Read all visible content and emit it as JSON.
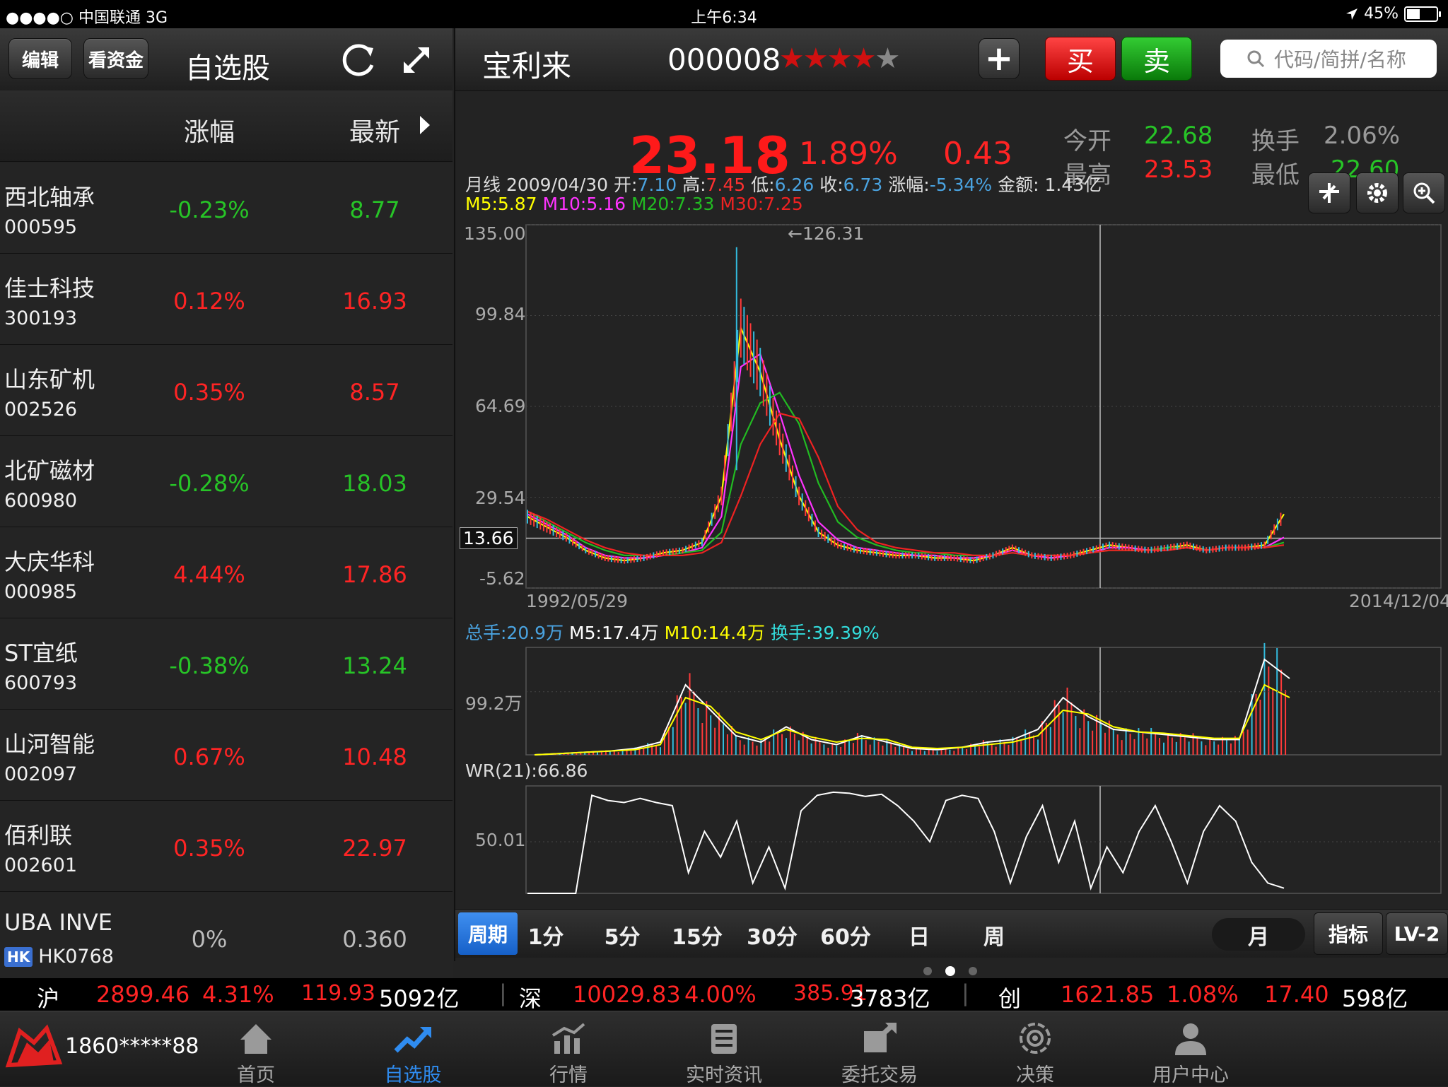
{
  "status_bar": {
    "carrier": "●●●●○ 中国联通  3G",
    "time": "上午6:34",
    "battery": "45%",
    "battery_level": 0.45
  },
  "watchlist": {
    "edit_label": "编辑",
    "funds_label": "看资金",
    "title": "自选股",
    "col_change": "涨幅",
    "col_latest": "最新",
    "rows": [
      {
        "name": "西北轴承",
        "code": "000595",
        "change": "-0.23%",
        "last": "8.77",
        "dir": "down"
      },
      {
        "name": "佳士科技",
        "code": "300193",
        "change": "0.12%",
        "last": "16.93",
        "dir": "up"
      },
      {
        "name": "山东矿机",
        "code": "002526",
        "change": "0.35%",
        "last": "8.57",
        "dir": "up"
      },
      {
        "name": "北矿磁材",
        "code": "600980",
        "change": "-0.28%",
        "last": "18.03",
        "dir": "down"
      },
      {
        "name": "大庆华科",
        "code": "000985",
        "change": "4.44%",
        "last": "17.86",
        "dir": "up"
      },
      {
        "name": "ST宜纸",
        "code": "600793",
        "change": "-0.38%",
        "last": "13.24",
        "dir": "down"
      },
      {
        "name": "山河智能",
        "code": "002097",
        "change": "0.67%",
        "last": "10.48",
        "dir": "up"
      },
      {
        "name": "佰利联",
        "code": "002601",
        "change": "0.35%",
        "last": "22.97",
        "dir": "up"
      },
      {
        "name": "UBA INVE",
        "code": "HK0768",
        "badge": "HK",
        "change": "0%",
        "last": "0.360",
        "dir": "flat"
      }
    ]
  },
  "stock": {
    "name": "宝利来",
    "code": "000008",
    "stars_filled": 4,
    "stars_total": 5,
    "add_label": "+",
    "buy_label": "买",
    "sell_label": "卖",
    "search_placeholder": "代码/简拼/名称",
    "price": "23.18",
    "change_pct": "1.89%",
    "change": "0.43",
    "open_label": "今开",
    "open": "22.68",
    "turnover_label": "换手",
    "turnover": "2.06%",
    "high_label": "最高",
    "high": "23.53",
    "low_label": "最低",
    "low": "22.60"
  },
  "chart_info": {
    "period": "月线",
    "date": "2009/04/30",
    "open_label": "开:",
    "open": "7.10",
    "high_label": "高:",
    "high": "7.45",
    "low_label": "低:",
    "low": "6.26",
    "close_label": "收:",
    "close": "6.73",
    "chg_label": "涨幅:",
    "chg": "-5.34%",
    "amount_label": "金额:",
    "amount": "1.43亿",
    "ma5": "M5:5.87",
    "ma10": "M10:5.16",
    "ma20": "M20:7.33",
    "ma30": "M30:7.25",
    "peak_label": "←126.31",
    "ref_price": "13.66",
    "start_date": "1992/05/29",
    "end_date": "2014/12/04",
    "vol_total": "总手:20.9万",
    "vol_m5": "M5:17.4万",
    "vol_m10": "M10:14.4万",
    "vol_turn": "换手:39.39%",
    "wr_label": "WR(21):66.86"
  },
  "chart_data": [
    {
      "type": "line",
      "title": "",
      "x_range": [
        "1992/05/29",
        "2014/12/04"
      ],
      "y_ticks": [
        135.0,
        99.84,
        64.69,
        29.54,
        13.66,
        -5.62
      ],
      "ylim": [
        -5.62,
        135.0
      ],
      "annotations": [
        {
          "label": "←126.31",
          "value": 126.31
        }
      ],
      "series": [
        {
          "name": "M5",
          "color": "#ffff00",
          "values": [
            22,
            18,
            14,
            9,
            6,
            5,
            6,
            8,
            9,
            12,
            30,
            95,
            78,
            52,
            30,
            16,
            11,
            9,
            8,
            7,
            7,
            6,
            6,
            5,
            7,
            10,
            7,
            6,
            7,
            9,
            11,
            10,
            9,
            10,
            11,
            9,
            10,
            10,
            11,
            23
          ]
        },
        {
          "name": "M10",
          "color": "#ff33ff",
          "values": [
            23,
            19,
            15,
            10,
            7,
            6,
            6,
            7,
            8,
            10,
            22,
            80,
            85,
            62,
            38,
            20,
            13,
            10,
            9,
            8,
            7,
            7,
            6,
            6,
            7,
            9,
            7,
            6,
            7,
            8,
            10,
            10,
            9,
            10,
            10,
            9,
            10,
            10,
            10,
            14
          ]
        },
        {
          "name": "M20",
          "color": "#22bb22",
          "values": [
            24,
            20,
            16,
            12,
            9,
            7,
            7,
            7,
            8,
            9,
            16,
            50,
            66,
            70,
            58,
            35,
            20,
            14,
            11,
            9,
            8,
            8,
            7,
            7,
            7,
            8,
            7,
            7,
            7,
            8,
            9,
            9,
            9,
            10,
            10,
            9,
            10,
            10,
            10,
            12
          ]
        },
        {
          "name": "M30",
          "color": "#ee2222",
          "values": [
            24,
            21,
            17,
            13,
            10,
            8,
            7,
            7,
            7,
            8,
            12,
            30,
            50,
            62,
            60,
            45,
            26,
            17,
            12,
            10,
            9,
            8,
            8,
            7,
            7,
            8,
            7,
            7,
            7,
            8,
            9,
            9,
            9,
            9,
            10,
            9,
            10,
            10,
            10,
            11
          ]
        }
      ]
    },
    {
      "type": "bar",
      "title": "",
      "y_ticks_label": [
        "99.2万"
      ],
      "series": [
        {
          "name": "M5",
          "color": "#ffffff",
          "values": [
            0,
            1,
            2,
            3,
            5,
            10,
            55,
            35,
            15,
            10,
            22,
            12,
            8,
            15,
            10,
            5,
            4,
            6,
            10,
            12,
            20,
            45,
            30,
            20,
            18,
            16,
            14,
            12,
            12,
            75,
            60
          ]
        },
        {
          "name": "M10",
          "color": "#ffff00",
          "values": [
            0,
            1,
            2,
            3,
            4,
            8,
            45,
            38,
            18,
            12,
            20,
            14,
            10,
            13,
            12,
            6,
            5,
            6,
            8,
            10,
            15,
            35,
            32,
            22,
            18,
            17,
            15,
            13,
            13,
            55,
            45
          ]
        }
      ]
    },
    {
      "type": "line",
      "title": "",
      "y_ticks": [
        50.01
      ],
      "series": [
        {
          "name": "WR(21)",
          "color": "#ffffff",
          "values": [
            0,
            0,
            0,
            0,
            95,
            90,
            88,
            92,
            88,
            85,
            20,
            60,
            35,
            70,
            10,
            45,
            5,
            80,
            95,
            98,
            97,
            94,
            96,
            85,
            70,
            50,
            90,
            95,
            92,
            60,
            10,
            55,
            85,
            30,
            70,
            5,
            45,
            20,
            60,
            85,
            50,
            10,
            60,
            85,
            70,
            30,
            10,
            5
          ]
        }
      ]
    }
  ],
  "periods": {
    "period_label": "周期",
    "items": [
      "1分",
      "5分",
      "15分",
      "30分",
      "60分",
      "日",
      "周",
      "月"
    ],
    "selected": "月",
    "indicator_label": "指标",
    "lv2_label": "LV-2"
  },
  "ticker": [
    {
      "name": "沪",
      "value": "2899.46",
      "pct": "4.31%",
      "chg": "119.93",
      "amount": "5092亿"
    },
    {
      "name": "深",
      "value": "10029.83",
      "pct": "4.00%",
      "chg": "385.91",
      "amount": "3783亿"
    },
    {
      "name": "创",
      "value": "1621.85",
      "pct": "1.08%",
      "chg": "17.40",
      "amount": "598亿"
    }
  ],
  "user": {
    "phone": "1860*****88"
  },
  "tabs": [
    {
      "label": "首页",
      "icon": "home-icon"
    },
    {
      "label": "自选股",
      "icon": "trend-icon"
    },
    {
      "label": "行情",
      "icon": "market-chart-icon"
    },
    {
      "label": "实时资讯",
      "icon": "news-icon"
    },
    {
      "label": "委托交易",
      "icon": "trade-icon"
    },
    {
      "label": "决策",
      "icon": "target-icon"
    },
    {
      "label": "用户中心",
      "icon": "user-icon"
    }
  ],
  "colors": {
    "up": "#ff2424",
    "down": "#27c427",
    "active_tab": "#2f8cf0",
    "accent_blue": "#3f8ff0"
  }
}
